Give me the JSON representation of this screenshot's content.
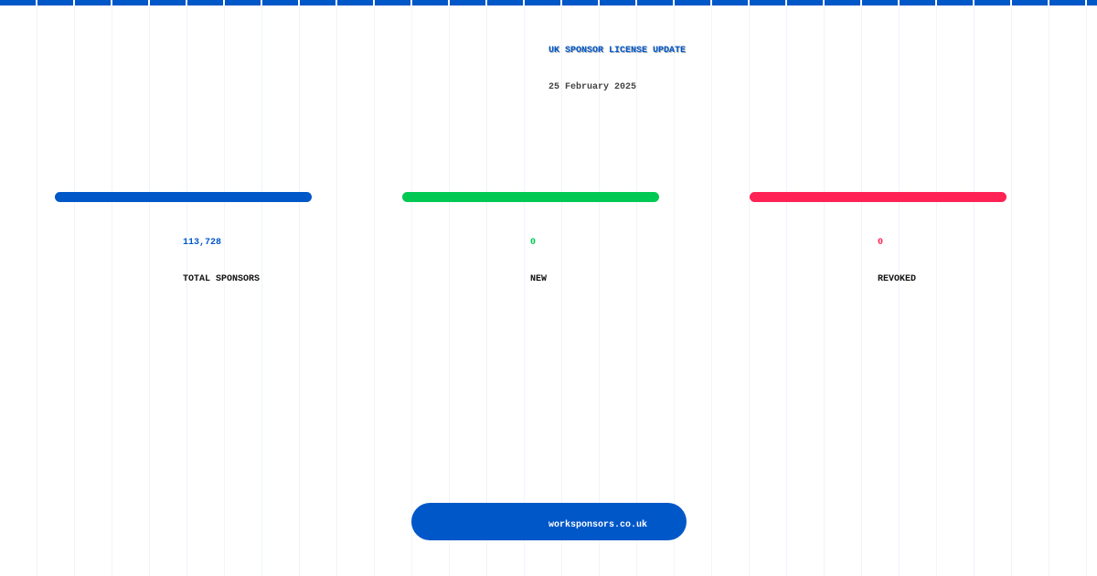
{
  "header": {
    "title": "UK SPONSOR LICENSE UPDATE",
    "date": "25 February 2025"
  },
  "stats": [
    {
      "value": "113,728",
      "label": "TOTAL SPONSORS",
      "color": "#0057c8"
    },
    {
      "value": "0",
      "label": "NEW",
      "color": "#00c853"
    },
    {
      "value": "0",
      "label": "REVOKED",
      "color": "#ff2255"
    }
  ],
  "footer": {
    "link": "worksponsors.co.uk"
  },
  "colors": {
    "brand": "#0057c8"
  }
}
